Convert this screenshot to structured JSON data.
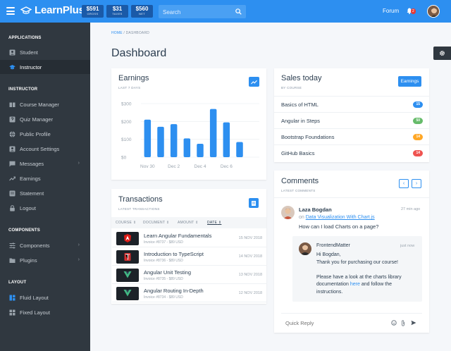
{
  "app": {
    "name": "LearnPlus"
  },
  "stats": [
    {
      "value": "$591",
      "label": "GROSS"
    },
    {
      "value": "$31",
      "label": "TAXES"
    },
    {
      "value": "$560",
      "label": "NET"
    }
  ],
  "search": {
    "placeholder": "Search"
  },
  "topnav": {
    "forum": "Forum",
    "notifications": "2"
  },
  "sidebar": {
    "applications": {
      "heading": "APPLICATIONS",
      "items": [
        {
          "label": "Student"
        },
        {
          "label": "Instructor"
        }
      ]
    },
    "instructor": {
      "heading": "INSTRUCTOR",
      "items": [
        {
          "label": "Course Manager"
        },
        {
          "label": "Quiz Manager"
        },
        {
          "label": "Public Profile"
        },
        {
          "label": "Account Settings"
        },
        {
          "label": "Messages"
        },
        {
          "label": "Earnings"
        },
        {
          "label": "Statement"
        },
        {
          "label": "Logout"
        }
      ]
    },
    "components": {
      "heading": "COMPONENTS",
      "items": [
        {
          "label": "Components"
        },
        {
          "label": "Plugins"
        }
      ]
    },
    "layout": {
      "heading": "LAYOUT",
      "items": [
        {
          "label": "Fluid Layout"
        },
        {
          "label": "Fixed Layout"
        }
      ]
    }
  },
  "breadcrumb": {
    "home": "HOME",
    "current": "DASHBOARD"
  },
  "page": {
    "title": "Dashboard"
  },
  "earnings": {
    "title": "Earnings",
    "subtitle": "LAST 7 DAYS"
  },
  "chart_data": {
    "type": "bar",
    "x": [
      1,
      2,
      3,
      4,
      5,
      6,
      7,
      8,
      9
    ],
    "values": [
      210,
      170,
      185,
      105,
      75,
      270,
      195,
      85,
      0
    ],
    "xticks": [
      "Nov 30",
      "Dec 2",
      "Dec 4",
      "Dec 6"
    ],
    "yticks": [
      "$0",
      "$100",
      "$200",
      "$300"
    ],
    "ylim": [
      0,
      300
    ],
    "color": "#2d8ff0",
    "grid": true
  },
  "sales": {
    "title": "Sales today",
    "subtitle": "BY COURSE",
    "button": "Earnings",
    "items": [
      {
        "name": "Basics of HTML",
        "count": "15",
        "color": "#2d8ff0"
      },
      {
        "name": "Angular in Steps",
        "count": "50",
        "color": "#66bb6a"
      },
      {
        "name": "Bootstrap Foundations",
        "count": "14",
        "color": "#ffa726"
      },
      {
        "name": "GitHub Basics",
        "count": "14",
        "color": "#ef5350"
      }
    ]
  },
  "transactions": {
    "title": "Transactions",
    "subtitle": "LATEST TRANSACTIONS",
    "columns": [
      "COURSE",
      "DOCUMENT",
      "AMOUNT",
      "DATE"
    ],
    "rows": [
      {
        "name": "Learn Angular Fundamentals",
        "info": "Invoice #8737 - $89 USD",
        "date": "15 NOV 2018"
      },
      {
        "name": "Introduction to TypeScript",
        "info": "Invoice #8736 - $89 USD",
        "date": "14 NOV 2018"
      },
      {
        "name": "Angular Unit Testing",
        "info": "Invoice #8735 - $89 USD",
        "date": "13 NOV 2018"
      },
      {
        "name": "Angular Routing In-Depth",
        "info": "Invoice #8734 - $89 USD",
        "date": "12 NOV 2018"
      }
    ]
  },
  "comments": {
    "title": "Comments",
    "subtitle": "LATEST COMMENTS",
    "first": {
      "author": "Laza Bogdan",
      "time": "27 min ago",
      "on": "on",
      "link": "Data Visualization With Chart.js",
      "text": "How can I load Charts on a page?"
    },
    "reply": {
      "author": "FrontendMatter",
      "time": "just now",
      "l1": "Hi Bogdan,",
      "l2": "Thank you for purchasing our course!",
      "l3": "Please have a look at the charts library",
      "l4a": "documentation",
      "l4link": "here",
      "l4b": "and follow the",
      "l5": "instructions."
    },
    "quick_reply": {
      "placeholder": "Quick Reply"
    }
  }
}
